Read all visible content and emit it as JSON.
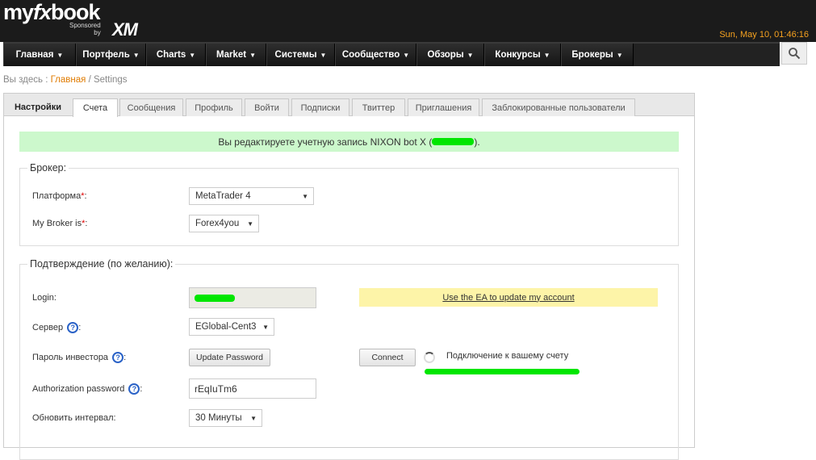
{
  "header": {
    "logo_my": "my",
    "logo_fx": "fx",
    "logo_book": "book",
    "sponsored_line1": "Sponsored",
    "sponsored_line2": "by",
    "sponsor": "XM",
    "datetime": "Sun, May 10, 01:46:16"
  },
  "nav": {
    "items": [
      {
        "label": "Главная"
      },
      {
        "label": "Портфель"
      },
      {
        "label": "Charts"
      },
      {
        "label": "Market"
      },
      {
        "label": "Системы"
      },
      {
        "label": "Сообщество"
      },
      {
        "label": "Обзоры"
      },
      {
        "label": "Конкурсы"
      },
      {
        "label": "Брокеры"
      }
    ],
    "search_icon": "search-icon"
  },
  "breadcrumb": {
    "prefix": "Вы здесь :",
    "home": "Главная",
    "separator": "/",
    "current": "Settings"
  },
  "tabs": {
    "title": "Настройки",
    "items": [
      {
        "label": "Счета",
        "active": true
      },
      {
        "label": "Сообщения"
      },
      {
        "label": "Профиль"
      },
      {
        "label": "Войти"
      },
      {
        "label": "Подписки"
      },
      {
        "label": "Твиттер"
      },
      {
        "label": "Приглашения"
      },
      {
        "label": "Заблокированные пользователи"
      }
    ]
  },
  "notice": {
    "text_before": "Вы редактируете учетную запись NIXON bot X (",
    "text_after": ")."
  },
  "broker": {
    "legend": "Брокер:",
    "platform_label": "Платформа",
    "platform_value": "MetaTrader 4",
    "broker_label": "My Broker is",
    "broker_value": "Forex4you",
    "required_mark": "*",
    "colon": ":"
  },
  "confirm": {
    "legend": "Подтверждение (по желанию):",
    "login_label": "Login:",
    "ea_link": "Use the EA to update my account",
    "server_label": "Сервер",
    "server_value": "EGlobal-Cent3",
    "investor_label": "Пароль инвестора",
    "update_password_button": "Update Password",
    "connect_button": "Connect",
    "connecting_text": "Подключение к вашему счету",
    "auth_label": "Authorization password",
    "auth_value": "rEqIuTm6",
    "interval_label": "Обновить интервал:",
    "interval_value": "30 Минуты",
    "help_glyph": "?",
    "colon": ":"
  },
  "colors": {
    "accent_orange": "#f6a21f",
    "notice_green": "#ccf8cc",
    "redaction_green": "#00e600",
    "ea_yellow": "#fdf4a8"
  }
}
